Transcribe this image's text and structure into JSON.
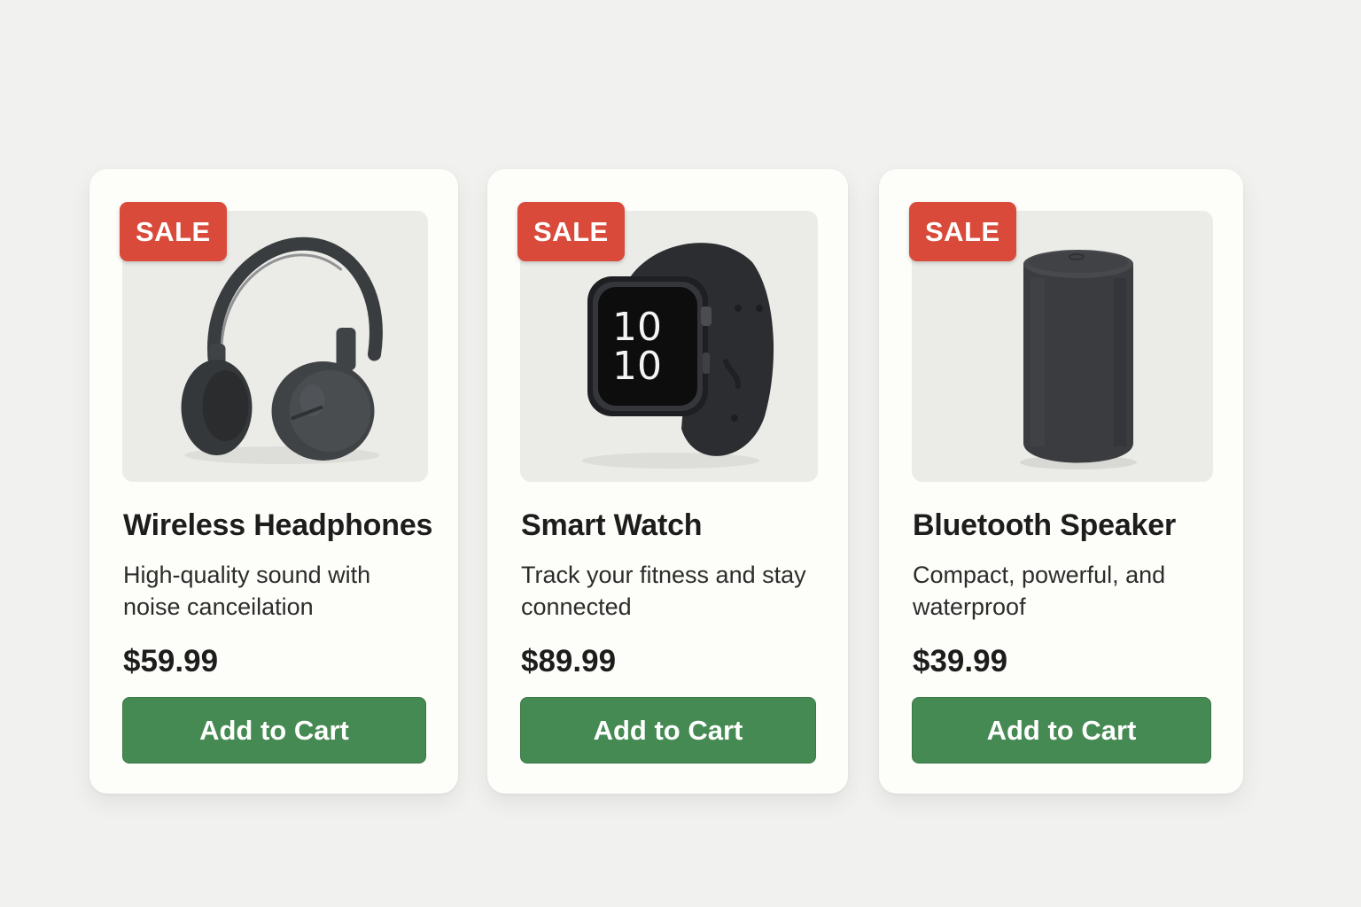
{
  "products": [
    {
      "badge": "SALE",
      "name": "Wireless Headphones",
      "description": "High-quality sound with noise canceilation",
      "price": "$59.99",
      "button": "Add to Cart",
      "image": "headphones-image"
    },
    {
      "badge": "SALE",
      "name": "Smart Watch",
      "description": "Track your fitness and stay connected",
      "price": "$89.99",
      "button": "Add to Cart",
      "image": "smart-watch-image",
      "watch_face": {
        "hours": "10",
        "minutes": "10"
      }
    },
    {
      "badge": "SALE",
      "name": "Bluetooth Speaker",
      "description": "Compact, powerful, and waterproof",
      "price": "$39.99",
      "button": "Add to Cart",
      "image": "speaker-image"
    }
  ],
  "colors": {
    "background": "#f1f1ef",
    "card": "#fdfdf9",
    "sale_badge": "#d94a3a",
    "add_to_cart": "#468a53",
    "product_dark": "#3d3f42"
  }
}
